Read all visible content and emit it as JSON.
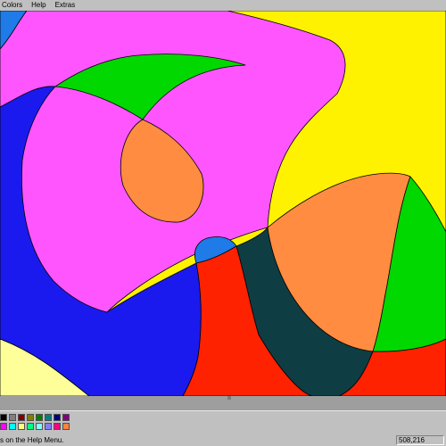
{
  "menubar": {
    "items": [
      {
        "label": "Colors"
      },
      {
        "label": "Help"
      },
      {
        "label": "Extras"
      }
    ]
  },
  "palette": {
    "colors": [
      "#000000",
      "#808080",
      "#800000",
      "#808000",
      "#008000",
      "#008080",
      "#000080",
      "#800080",
      "#ff00ff",
      "#00ffff",
      "#ffff80",
      "#00ff80",
      "#80ffff",
      "#8080ff",
      "#ff0080",
      "#ff8040"
    ]
  },
  "statusbar": {
    "message": "s on the Help Menu.",
    "coords": "508,216"
  },
  "canvas": {
    "region_colors": {
      "yellow": "#fff200",
      "magenta": "#ff55ff",
      "green": "#00d800",
      "orange": "#ff8c40",
      "blue": "#1a1aee",
      "light_blue": "#1e7be8",
      "red": "#ff2200",
      "dark_teal": "#0f3d44",
      "pale_yellow": "#ffff99"
    }
  }
}
